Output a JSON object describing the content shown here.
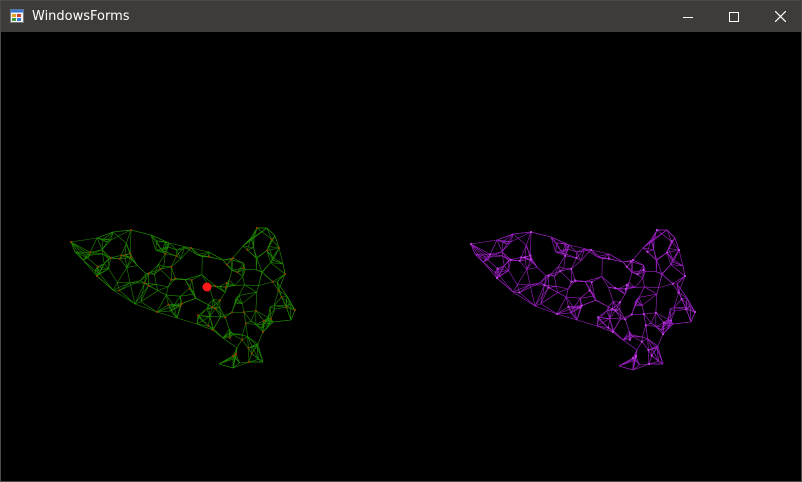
{
  "window": {
    "title": "WindowsForms",
    "icon": "windows-forms-app-icon"
  },
  "caption_buttons": [
    {
      "name": "minimize",
      "icon": "minimize-icon"
    },
    {
      "name": "maximize",
      "icon": "maximize-icon"
    },
    {
      "name": "close",
      "icon": "close-icon"
    }
  ],
  "scene": {
    "background": "#000000",
    "left_mesh": {
      "wire_color": "#1f8a00",
      "vertex_color": "#8a3a00",
      "marker_color": "#ff1a1a"
    },
    "right_mesh": {
      "wire_color": "#a020c8",
      "vertex_color": "#c040e0"
    }
  }
}
